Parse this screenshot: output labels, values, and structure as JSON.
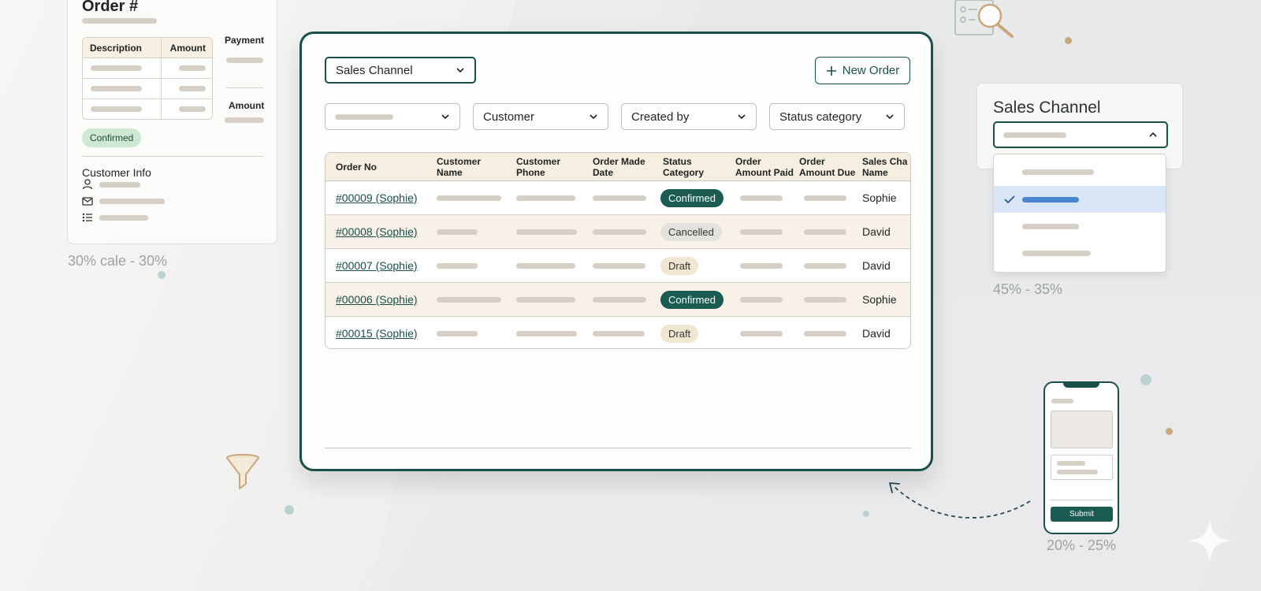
{
  "order_card": {
    "title": "Order #",
    "table": {
      "col_description": "Description",
      "col_amount": "Amount"
    },
    "payment_label": "Payment",
    "amount_label": "Amount",
    "status_badge": "Confirmed",
    "customer_info_title": "Customer Info",
    "icons": [
      "person-icon",
      "mail-icon",
      "list-icon"
    ],
    "caption": "30% cale - 30%"
  },
  "main": {
    "sales_channel_select": "Sales Channel",
    "new_order_button": "New Order",
    "filters": {
      "first_value": "",
      "customer": "Customer",
      "created_by": "Created by",
      "status_category": "Status category"
    },
    "table": {
      "headers": [
        "Order No",
        "Customer\nName",
        "Customer\nPhone",
        "Order Made\nDate",
        "Status\nCategory",
        "Order\nAmount Paid",
        "Order\nAmount Due",
        "Sales Cha\nName"
      ],
      "rows": [
        {
          "order_no": "#00009 (Sophie)",
          "status": "Confirmed",
          "sales_channel": "Sophie"
        },
        {
          "order_no": "#00008 (Sophie)",
          "status": "Cancelled",
          "sales_channel": "David"
        },
        {
          "order_no": "#00007 (Sophie)",
          "status": "Draft",
          "sales_channel": "David"
        },
        {
          "order_no": "#00006 (Sophie)",
          "status": "Confirmed",
          "sales_channel": "Sophie"
        },
        {
          "order_no": "#00015 (Sophie)",
          "status": "Draft",
          "sales_channel": "David"
        }
      ]
    }
  },
  "sales_channel_panel": {
    "title": "Sales Channel",
    "selected_option_index": 1,
    "option_count": 4,
    "caption": "45% - 35%"
  },
  "phone": {
    "submit_button": "Submit",
    "caption": "20% - 25%"
  },
  "colors": {
    "accent": "#1a4e48",
    "confirmed": "#1a5c52",
    "cancelled": "#e4e2df",
    "draft": "#f1e6d2",
    "header_bg": "#f5eee1",
    "selected_option": "#d8e6f7"
  }
}
